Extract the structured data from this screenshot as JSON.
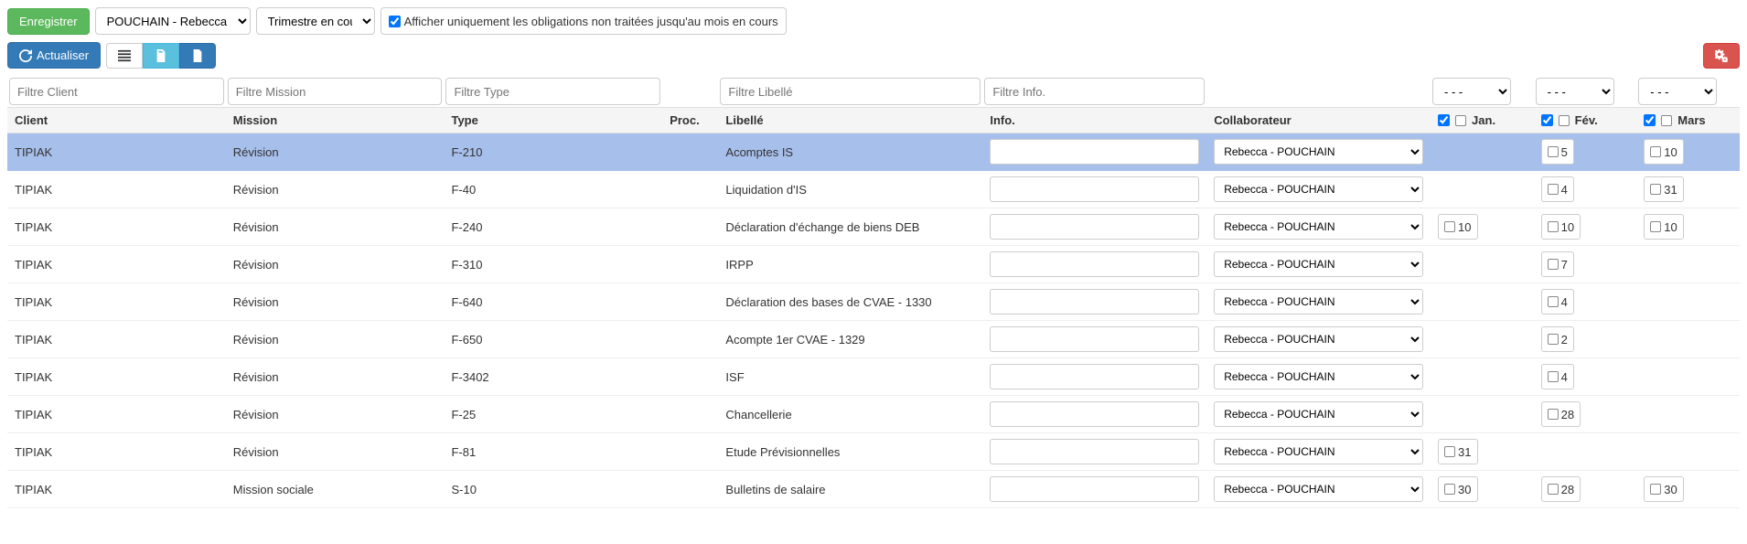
{
  "toolbar": {
    "save": "Enregistrer",
    "person_select": "POUCHAIN - Rebecca - RP",
    "period_select": "Trimestre en cours",
    "only_pending_label": "Afficher uniquement les obligations non traitées jusqu'au mois en cours",
    "refresh": "Actualiser"
  },
  "filters": {
    "client_ph": "Filtre Client",
    "mission_ph": "Filtre Mission",
    "type_ph": "Filtre Type",
    "libelle_ph": "Filtre Libellé",
    "info_ph": "Filtre Info.",
    "month_placeholder": "- - -"
  },
  "headers": {
    "client": "Client",
    "mission": "Mission",
    "type": "Type",
    "proc": "Proc.",
    "libelle": "Libellé",
    "info": "Info.",
    "collab": "Collaborateur",
    "jan": "Jan.",
    "fev": "Fév.",
    "mars": "Mars"
  },
  "collab_option": "Rebecca - POUCHAIN",
  "rows": [
    {
      "client": "TIPIAK",
      "mission": "Révision",
      "type": "F-210",
      "libelle": "Acomptes IS",
      "jan": "",
      "fev": "5",
      "mars": "10",
      "selected": true
    },
    {
      "client": "TIPIAK",
      "mission": "Révision",
      "type": "F-40",
      "libelle": "Liquidation d'IS",
      "jan": "",
      "fev": "4",
      "mars": "31"
    },
    {
      "client": "TIPIAK",
      "mission": "Révision",
      "type": "F-240",
      "libelle": "Déclaration d'échange de biens DEB",
      "jan": "10",
      "fev": "10",
      "mars": "10"
    },
    {
      "client": "TIPIAK",
      "mission": "Révision",
      "type": "F-310",
      "libelle": "IRPP",
      "jan": "",
      "fev": "7",
      "mars": ""
    },
    {
      "client": "TIPIAK",
      "mission": "Révision",
      "type": "F-640",
      "libelle": "Déclaration des bases de CVAE - 1330",
      "jan": "",
      "fev": "4",
      "mars": ""
    },
    {
      "client": "TIPIAK",
      "mission": "Révision",
      "type": "F-650",
      "libelle": "Acompte 1er CVAE - 1329",
      "jan": "",
      "fev": "2",
      "mars": ""
    },
    {
      "client": "TIPIAK",
      "mission": "Révision",
      "type": "F-3402",
      "libelle": "ISF",
      "jan": "",
      "fev": "4",
      "mars": ""
    },
    {
      "client": "TIPIAK",
      "mission": "Révision",
      "type": "F-25",
      "libelle": "Chancellerie",
      "jan": "",
      "fev": "28",
      "mars": ""
    },
    {
      "client": "TIPIAK",
      "mission": "Révision",
      "type": "F-81",
      "libelle": "Etude Prévisionnelles",
      "jan": "31",
      "fev": "",
      "mars": ""
    },
    {
      "client": "TIPIAK",
      "mission": "Mission sociale",
      "type": "S-10",
      "libelle": "Bulletins de salaire",
      "jan": "30",
      "fev": "28",
      "mars": "30"
    }
  ]
}
